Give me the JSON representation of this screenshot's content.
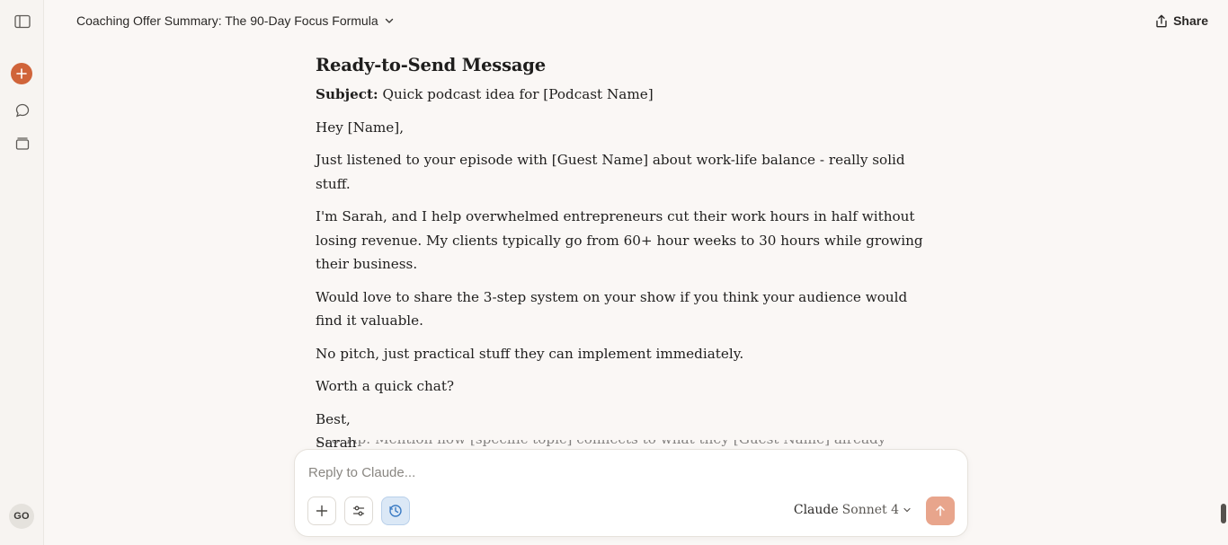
{
  "header": {
    "title": "Coaching Offer Summary: The 90-Day Focus Formula",
    "share_label": "Share"
  },
  "sidebar": {
    "avatar_initials": "GO",
    "icons": [
      "sidebar-toggle-icon",
      "new-chat-icon",
      "chats-icon",
      "projects-icon"
    ],
    "accent": "#d0643a"
  },
  "message": {
    "heading": "Ready-to-Send Message",
    "subject_label": "Subject:",
    "subject_text": "Quick podcast idea for [Podcast Name]",
    "paragraphs": [
      "Hey [Name],",
      "Just listened to your episode with [Guest Name] about work-life balance - really solid stuff.",
      "I'm Sarah, and I help overwhelmed entrepreneurs cut their work hours in half without losing revenue. My clients typically go from 60+ hour weeks to 30 hours while growing their business.",
      "Would love to share the 3-step system on your show if you think your audience would find it valuable.",
      "No pitch, just practical stuff they can implement immediately.",
      "Worth a quick chat?"
    ],
    "signoff": "Best,",
    "signature": "Sarah",
    "partial_line": "Pro Tip: Mention how [specific topic] connects to what they [Guest Name] already covered"
  },
  "composer": {
    "placeholder": "Reply to Claude...",
    "model_name": "Claude",
    "model_version": "Sonnet 4",
    "send_color": "#e8a58c"
  }
}
